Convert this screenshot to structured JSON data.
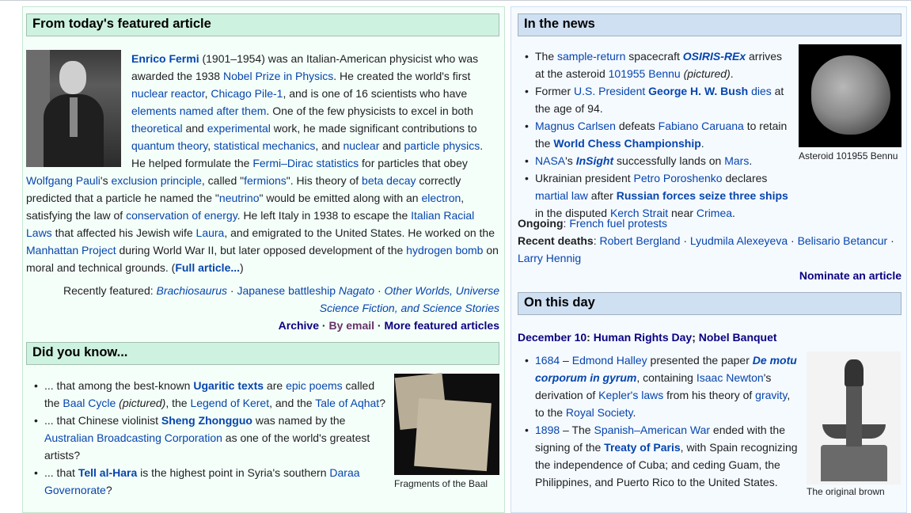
{
  "featured": {
    "heading": "From today's featured article",
    "body": [
      {
        "t": "Enrico Fermi",
        "l": 1,
        "b": 1
      },
      {
        "t": " (1901–1954) was an Italian-American physicist who was awarded the 1938 "
      },
      {
        "t": "Nobel Prize in Physics",
        "l": 1
      },
      {
        "t": ". He created the world's first "
      },
      {
        "t": "nuclear reactor",
        "l": 1
      },
      {
        "t": ", "
      },
      {
        "t": "Chicago Pile-1",
        "l": 1
      },
      {
        "t": ", and is one of 16 scientists who have "
      },
      {
        "t": "elements named after them",
        "l": 1
      },
      {
        "t": ". One of the few physicists to excel in both "
      },
      {
        "t": "theoretical",
        "l": 1
      },
      {
        "t": " and "
      },
      {
        "t": "experimental",
        "l": 1
      },
      {
        "t": " work, he made significant contributions to "
      },
      {
        "t": "quantum theory",
        "l": 1
      },
      {
        "t": ", "
      },
      {
        "t": "statistical mechanics",
        "l": 1
      },
      {
        "t": ", and "
      },
      {
        "t": "nuclear",
        "l": 1
      },
      {
        "t": " and "
      },
      {
        "t": "particle physics",
        "l": 1
      },
      {
        "t": ". He helped formulate the "
      },
      {
        "t": "Fermi–Dirac statistics",
        "l": 1
      },
      {
        "t": " for particles that obey "
      },
      {
        "t": "Wolfgang Pauli",
        "l": 1
      },
      {
        "t": "'s "
      },
      {
        "t": "exclusion principle",
        "l": 1
      },
      {
        "t": ", called \""
      },
      {
        "t": "fermions",
        "l": 1
      },
      {
        "t": "\". His theory of "
      },
      {
        "t": "beta decay",
        "l": 1
      },
      {
        "t": " correctly predicted that a particle he named the \""
      },
      {
        "t": "neutrino",
        "l": 1
      },
      {
        "t": "\" would be emitted along with an "
      },
      {
        "t": "electron",
        "l": 1
      },
      {
        "t": ", satisfying the law of "
      },
      {
        "t": "conservation of energy",
        "l": 1
      },
      {
        "t": ". He left Italy in 1938 to escape the "
      },
      {
        "t": "Italian Racial Laws",
        "l": 1
      },
      {
        "t": " that affected his Jewish wife "
      },
      {
        "t": "Laura",
        "l": 1
      },
      {
        "t": ", and emigrated to the United States. He worked on the "
      },
      {
        "t": "Manhattan Project",
        "l": 1
      },
      {
        "t": " during World War II, but later opposed development of the "
      },
      {
        "t": "hydrogen bomb",
        "l": 1
      },
      {
        "t": " on moral and technical grounds. ("
      },
      {
        "t": "Full article...",
        "l": 1,
        "b": 1
      },
      {
        "t": ")"
      }
    ],
    "recently_label": "Recently featured: ",
    "recently": [
      {
        "t": "Brachiosaurus",
        "l": 1,
        "i": 1
      },
      {
        "t": " · "
      },
      {
        "t": "Japanese battleship Nagato",
        "l": 1,
        "ip": "Nagato"
      },
      {
        "t": " · "
      },
      {
        "t": "Other Worlds, Universe Science Fiction, and Science Stories",
        "l": 1,
        "i": 1
      }
    ],
    "archive": "Archive",
    "by_email": "By email",
    "more": "More featured articles",
    "sep": " · "
  },
  "dyk": {
    "heading": "Did you know...",
    "items": [
      [
        {
          "t": "... that among the best-known "
        },
        {
          "t": "Ugaritic texts",
          "l": 1,
          "b": 1
        },
        {
          "t": " are "
        },
        {
          "t": "epic poems",
          "l": 1
        },
        {
          "t": " called the "
        },
        {
          "t": "Baal Cycle",
          "l": 1
        },
        {
          "t": " (pictured)",
          "i": 1
        },
        {
          "t": ", the "
        },
        {
          "t": "Legend of Keret",
          "l": 1
        },
        {
          "t": ", and the "
        },
        {
          "t": "Tale of Aqhat",
          "l": 1
        },
        {
          "t": "?"
        }
      ],
      [
        {
          "t": "... that Chinese violinist "
        },
        {
          "t": "Sheng Zhongguo",
          "l": 1,
          "b": 1
        },
        {
          "t": " was named by the "
        },
        {
          "t": "Australian Broadcasting Corporation",
          "l": 1
        },
        {
          "t": " as one of the world's greatest artists?"
        }
      ],
      [
        {
          "t": "... that "
        },
        {
          "t": "Tell al-Hara",
          "l": 1,
          "b": 1
        },
        {
          "t": " is the highest point in Syria's southern "
        },
        {
          "t": "Daraa Governorate",
          "l": 1
        },
        {
          "t": "?"
        }
      ]
    ],
    "caption": "Fragments of the Baal Cycle"
  },
  "news": {
    "heading": "In the news",
    "items": [
      [
        {
          "t": "The "
        },
        {
          "t": "sample-return",
          "l": 1
        },
        {
          "t": " spacecraft "
        },
        {
          "t": "OSIRIS-REx",
          "l": 1,
          "b": 1,
          "i": 1
        },
        {
          "t": " arrives at the asteroid "
        },
        {
          "t": "101955 Bennu",
          "l": 1
        },
        {
          "t": " (pictured)",
          "i": 1
        },
        {
          "t": "."
        }
      ],
      [
        {
          "t": "Former "
        },
        {
          "t": "U.S. President",
          "l": 1
        },
        {
          "t": " "
        },
        {
          "t": "George H. W. Bush",
          "l": 1,
          "b": 1
        },
        {
          "t": " "
        },
        {
          "t": "dies",
          "l": 1
        },
        {
          "t": " at the age of 94."
        }
      ],
      [
        {
          "t": "Magnus Carlsen",
          "l": 1
        },
        {
          "t": " defeats "
        },
        {
          "t": "Fabiano Caruana",
          "l": 1
        },
        {
          "t": " to retain the "
        },
        {
          "t": "World Chess Championship",
          "l": 1,
          "b": 1
        },
        {
          "t": "."
        }
      ],
      [
        {
          "t": "NASA",
          "l": 1
        },
        {
          "t": "'s "
        },
        {
          "t": "InSight",
          "l": 1,
          "b": 1,
          "i": 1
        },
        {
          "t": " successfully lands on "
        },
        {
          "t": "Mars",
          "l": 1
        },
        {
          "t": "."
        }
      ],
      [
        {
          "t": "Ukrainian president "
        },
        {
          "t": "Petro Poroshenko",
          "l": 1
        },
        {
          "t": " declares "
        },
        {
          "t": "martial law",
          "l": 1
        },
        {
          "t": " after "
        },
        {
          "t": "Russian forces seize three ships",
          "l": 1,
          "b": 1
        },
        {
          "t": " in the disputed "
        },
        {
          "t": "Kerch Strait",
          "l": 1
        },
        {
          "t": " near "
        },
        {
          "t": "Crimea",
          "l": 1
        },
        {
          "t": "."
        }
      ]
    ],
    "caption": "Asteroid 101955 Bennu",
    "ongoing_label": "Ongoing",
    "ongoing": "French fuel protests",
    "deaths_label": "Recent deaths",
    "deaths": [
      "Robert Bergland",
      "Lyudmila Alexeyeva",
      "Belisario Betancur",
      "Larry Hennig"
    ],
    "nominate": "Nominate an article"
  },
  "otd": {
    "heading": "On this day",
    "date": "December 10",
    "events": "Human Rights Day",
    "events2": "Nobel Banquet",
    "items": [
      [
        {
          "t": "1684",
          "l": 1
        },
        {
          "t": " – "
        },
        {
          "t": "Edmond Halley",
          "l": 1
        },
        {
          "t": " presented the paper "
        },
        {
          "t": "De motu corporum in gyrum",
          "l": 1,
          "b": 1,
          "i": 1
        },
        {
          "t": ", containing "
        },
        {
          "t": "Isaac Newton",
          "l": 1
        },
        {
          "t": "'s derivation of "
        },
        {
          "t": "Kepler's laws",
          "l": 1
        },
        {
          "t": " from his theory of "
        },
        {
          "t": "gravity",
          "l": 1
        },
        {
          "t": ", to the "
        },
        {
          "t": "Royal Society",
          "l": 1
        },
        {
          "t": "."
        }
      ],
      [
        {
          "t": "1898",
          "l": 1
        },
        {
          "t": " – The "
        },
        {
          "t": "Spanish–American War",
          "l": 1
        },
        {
          "t": " ended with the signing of the "
        },
        {
          "t": "Treaty of Paris",
          "l": 1,
          "b": 1
        },
        {
          "t": ", with Spain recognizing the independence of Cuba; and ceding Guam, the Philippines, and Puerto Rico to the United States."
        }
      ]
    ],
    "caption": "The original brown"
  }
}
